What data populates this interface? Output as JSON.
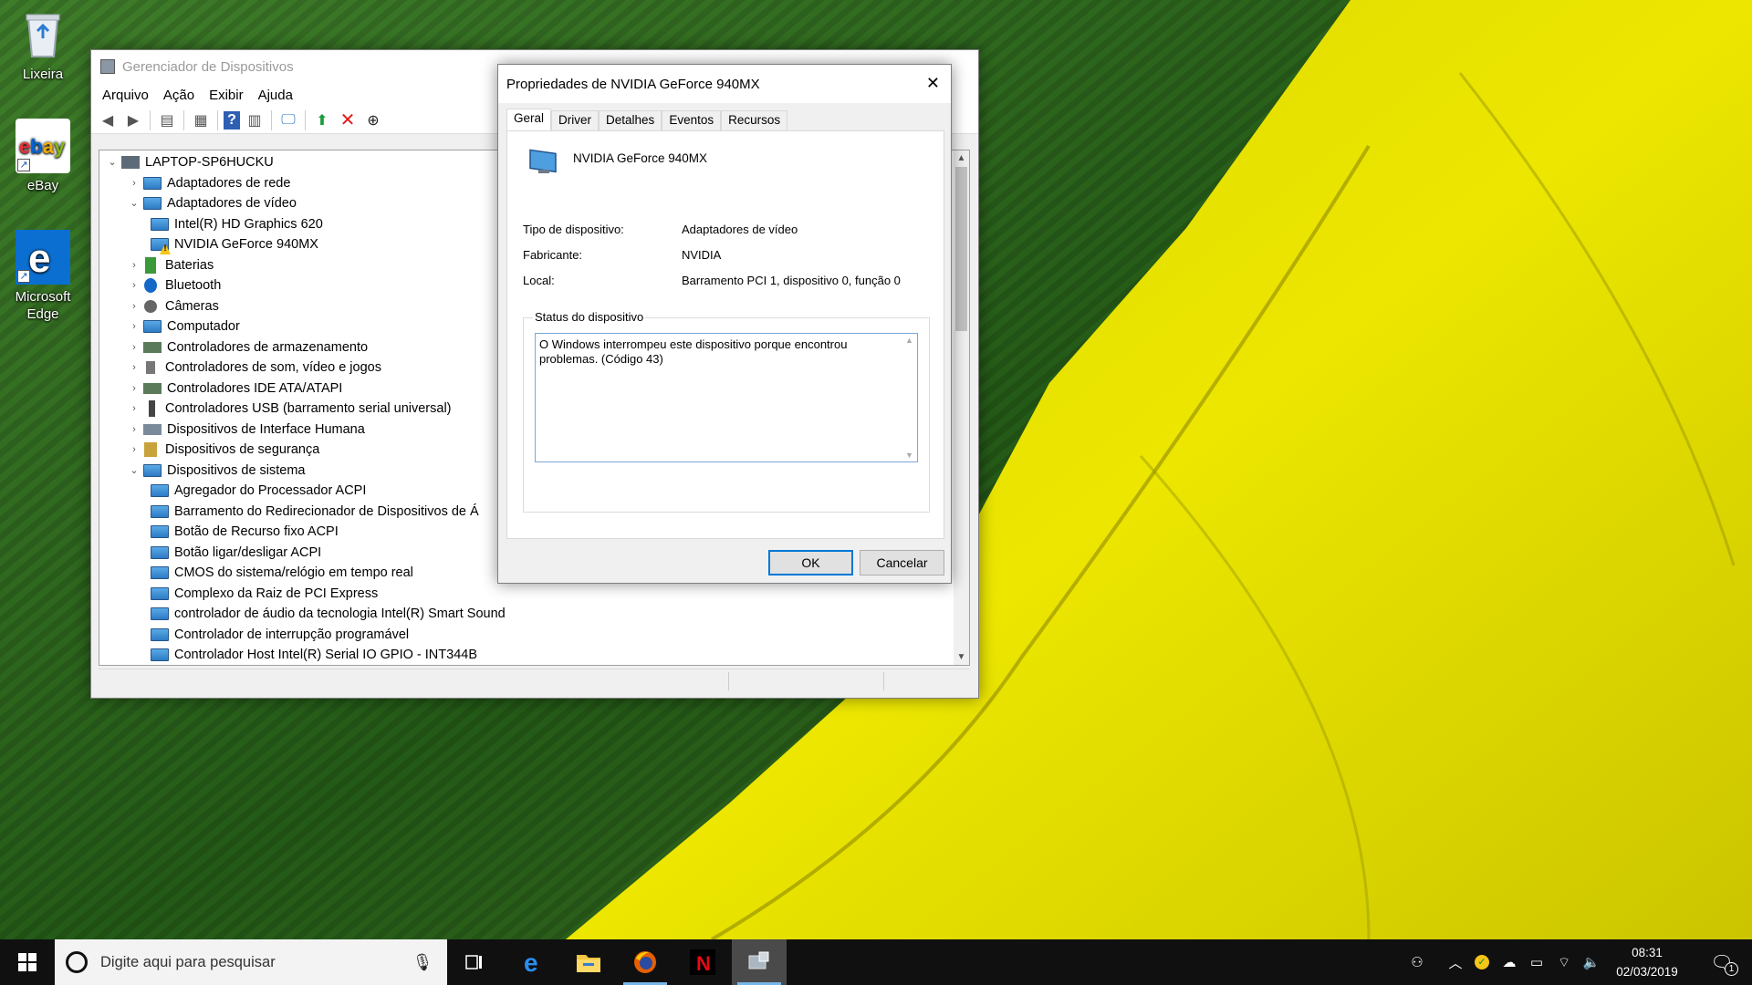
{
  "desktop": {
    "icons": [
      {
        "label": "Lixeira",
        "icon": "recycle-bin-icon"
      },
      {
        "label": "eBay",
        "icon": "ebay-icon"
      },
      {
        "label": "Microsoft Edge",
        "icon": "edge-icon"
      }
    ]
  },
  "device_manager": {
    "title": "Gerenciador de Dispositivos",
    "menu": [
      "Arquivo",
      "Ação",
      "Exibir",
      "Ajuda"
    ],
    "toolbar_icons": [
      "back-icon",
      "forward-icon",
      "view-icon",
      "properties-icon",
      "help-icon",
      "update-driver-icon",
      "scan-monitor-icon",
      "add-driver-icon",
      "uninstall-icon",
      "download-icon"
    ],
    "tree": {
      "root": "LAPTOP-SP6HUCKU",
      "items": [
        {
          "label": "Adaptadores de rede",
          "level": 1,
          "expanded": false
        },
        {
          "label": "Adaptadores de vídeo",
          "level": 1,
          "expanded": true
        },
        {
          "label": "Intel(R) HD Graphics 620",
          "level": 2
        },
        {
          "label": "NVIDIA GeForce 940MX",
          "level": 2,
          "warning": true
        },
        {
          "label": "Baterias",
          "level": 1,
          "expanded": false
        },
        {
          "label": "Bluetooth",
          "level": 1,
          "expanded": false
        },
        {
          "label": "Câmeras",
          "level": 1,
          "expanded": false
        },
        {
          "label": "Computador",
          "level": 1,
          "expanded": false
        },
        {
          "label": "Controladores de armazenamento",
          "level": 1,
          "expanded": false
        },
        {
          "label": "Controladores de som, vídeo e jogos",
          "level": 1,
          "expanded": false
        },
        {
          "label": "Controladores IDE ATA/ATAPI",
          "level": 1,
          "expanded": false
        },
        {
          "label": "Controladores USB (barramento serial universal)",
          "level": 1,
          "expanded": false
        },
        {
          "label": "Dispositivos de Interface Humana",
          "level": 1,
          "expanded": false
        },
        {
          "label": "Dispositivos de segurança",
          "level": 1,
          "expanded": false
        },
        {
          "label": "Dispositivos de sistema",
          "level": 1,
          "expanded": true
        },
        {
          "label": "Agregador do Processador ACPI",
          "level": 2
        },
        {
          "label": "Barramento do Redirecionador de Dispositivos de Á",
          "level": 2
        },
        {
          "label": "Botão de Recurso fixo ACPI",
          "level": 2
        },
        {
          "label": "Botão ligar/desligar ACPI",
          "level": 2
        },
        {
          "label": "CMOS do sistema/relógio em tempo real",
          "level": 2
        },
        {
          "label": "Complexo da Raiz de PCI Express",
          "level": 2
        },
        {
          "label": "controlador de áudio da tecnologia Intel(R) Smart Sound",
          "level": 2
        },
        {
          "label": "Controlador de interrupção programável",
          "level": 2
        },
        {
          "label": "Controlador Host Intel(R) Serial IO GPIO - INT344B",
          "level": 2
        }
      ]
    }
  },
  "properties_dialog": {
    "title": "Propriedades de NVIDIA GeForce 940MX",
    "tabs": [
      "Geral",
      "Driver",
      "Detalhes",
      "Eventos",
      "Recursos"
    ],
    "active_tab": "Geral",
    "device_name": "NVIDIA GeForce 940MX",
    "fields": [
      {
        "label": "Tipo de dispositivo:",
        "value": "Adaptadores de vídeo"
      },
      {
        "label": "Fabricante:",
        "value": "NVIDIA"
      },
      {
        "label": "Local:",
        "value": "Barramento PCI 1, dispositivo 0, função 0"
      }
    ],
    "status_group_label": "Status do dispositivo",
    "status_text": "O Windows interrompeu este dispositivo porque encontrou\nproblemas. (Código 43)",
    "ok_label": "OK",
    "cancel_label": "Cancelar"
  },
  "taskbar": {
    "search_placeholder": "Digite aqui para pesquisar",
    "apps": [
      "task-view-icon",
      "edge-icon",
      "file-explorer-icon",
      "firefox-icon",
      "netflix-icon",
      "device-manager-icon"
    ],
    "clock_time": "08:31",
    "clock_date": "02/03/2019",
    "notification_count": "1"
  },
  "colors": {
    "accent": "#0078d7",
    "taskbar": "#101010",
    "wallpaper_green": "#2f6b1c",
    "wallpaper_yellow": "#e8e000"
  }
}
